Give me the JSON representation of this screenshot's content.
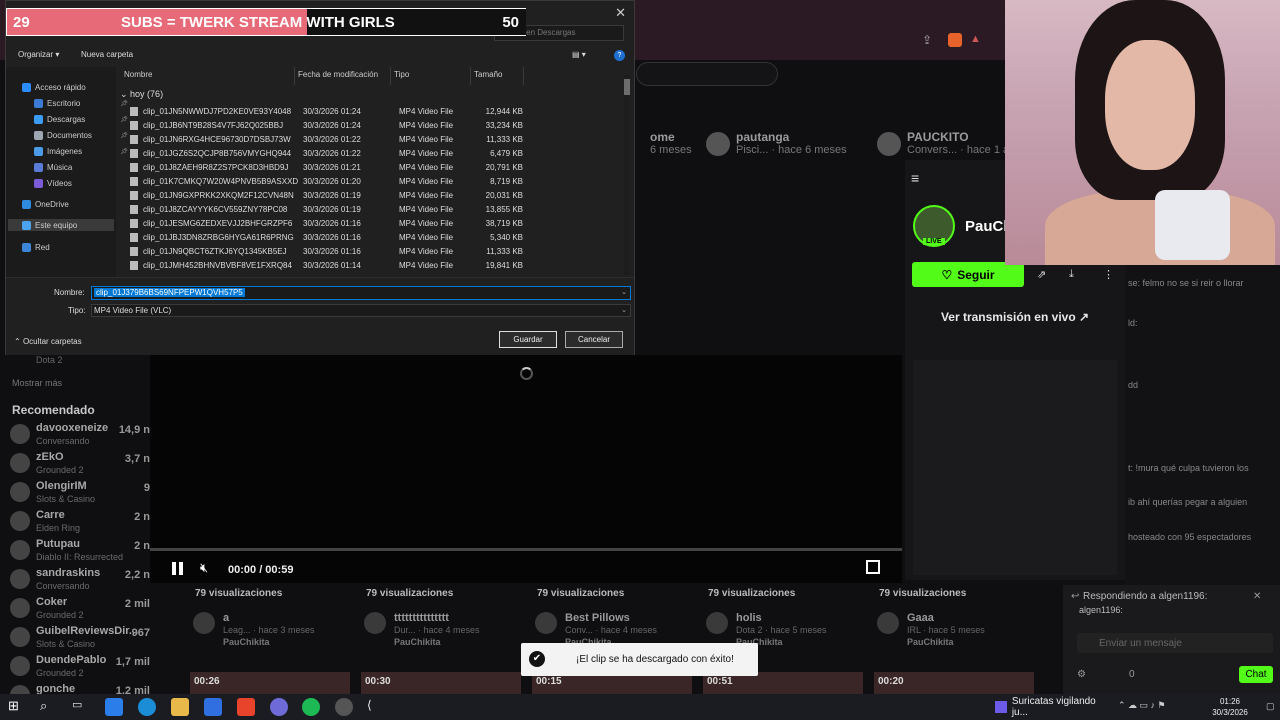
{
  "banner": {
    "left_count": "29",
    "title": "SUBS = TWERK STREAM WITH GIRLS",
    "right_count": "50"
  },
  "dialog": {
    "search_placeholder": "Buscar en Descargas",
    "toolbar": {
      "organize": "Organizar ▾",
      "new_folder": "Nueva carpeta"
    },
    "close_glyph": "✕",
    "nav": [
      {
        "label": "Acceso rápido",
        "icon": "star-icon",
        "color": "#2b8cff"
      },
      {
        "label": "Escritorio",
        "icon": "desktop-icon",
        "color": "#3b7bd6"
      },
      {
        "label": "Descargas",
        "icon": "download-icon",
        "color": "#3b9cf3"
      },
      {
        "label": "Documentos",
        "icon": "documents-icon",
        "color": "#9fa7b3"
      },
      {
        "label": "Imágenes",
        "icon": "pictures-icon",
        "color": "#4c9be8"
      },
      {
        "label": "Música",
        "icon": "music-icon",
        "color": "#5a7bd8"
      },
      {
        "label": "Vídeos",
        "icon": "video-icon",
        "color": "#7b5bd8"
      },
      {
        "label": "OneDrive",
        "icon": "cloud-icon",
        "color": "#2f8be0"
      },
      {
        "label": "Este equipo",
        "icon": "computer-icon",
        "color": "#4ba3f0"
      },
      {
        "label": "Red",
        "icon": "network-icon",
        "color": "#3b86d6"
      }
    ],
    "columns": {
      "name": "Nombre",
      "date": "Fecha de modificación",
      "type": "Tipo",
      "size": "Tamaño"
    },
    "group": "hoy (76)",
    "files": [
      {
        "name": "clip_01JN5NWWDJ7PD2KE0VE93Y4048",
        "date": "30/3/2026 01:24",
        "type": "MP4 Video File",
        "size": "12,944 KB"
      },
      {
        "name": "clip_01JB6NT9B28S4V7FJ62Q025BBJ",
        "date": "30/3/2026 01:24",
        "type": "MP4 Video File",
        "size": "33,234 KB"
      },
      {
        "name": "clip_01JN6RXG4HCE96730D7DSBJ73W",
        "date": "30/3/2026 01:22",
        "type": "MP4 Video File",
        "size": "11,333 KB"
      },
      {
        "name": "clip_01JGZ6S2QCJP8B756VMYGHQ944",
        "date": "30/3/2026 01:22",
        "type": "MP4 Video File",
        "size": "6,479 KB"
      },
      {
        "name": "clip_01J8ZAEH9R8Z2S7PCK8D3HBD9J",
        "date": "30/3/2026 01:21",
        "type": "MP4 Video File",
        "size": "20,791 KB"
      },
      {
        "name": "clip_01K7CMKQ7W20W4PNVB5B9ASXXD",
        "date": "30/3/2026 01:20",
        "type": "MP4 Video File",
        "size": "8,719 KB"
      },
      {
        "name": "clip_01JN9GXPRKK2XKQM2F12CVN48N",
        "date": "30/3/2026 01:19",
        "type": "MP4 Video File",
        "size": "20,031 KB"
      },
      {
        "name": "clip_01J8ZCAYYYK6CV559ZNY78PC08",
        "date": "30/3/2026 01:19",
        "type": "MP4 Video File",
        "size": "13,855 KB"
      },
      {
        "name": "clip_01JESMG6ZEDXEVJJ2BHFGRZPF6",
        "date": "30/3/2026 01:16",
        "type": "MP4 Video File",
        "size": "38,719 KB"
      },
      {
        "name": "clip_01JBJ3DN8ZRBG6HYGA61R6PRNG",
        "date": "30/3/2026 01:16",
        "type": "MP4 Video File",
        "size": "5,340 KB"
      },
      {
        "name": "clip_01JN9QBCT6ZTKJ6YQ1345KB5EJ",
        "date": "30/3/2026 01:16",
        "type": "MP4 Video File",
        "size": "11,333 KB"
      },
      {
        "name": "clip_01JMH452BHNVBVBF8VE1FXRQ84",
        "date": "30/3/2026 01:14",
        "type": "MP4 Video File",
        "size": "19,841 KB"
      }
    ],
    "filename_label": "Nombre:",
    "filename_value": "clip_01J379B6BS69NFPEPW1QVH57P5",
    "filetype_label": "Tipo:",
    "filetype_value": "MP4 Video File (VLC)",
    "hide_folders": "Ocultar carpetas",
    "save_button": "Guardar",
    "cancel_button": "Cancelar"
  },
  "background": {
    "cards": [
      {
        "title": "ome",
        "meta": "6 meses"
      },
      {
        "title": "pautanga",
        "meta": "Pisci... · hace 6 meses"
      },
      {
        "title": "PAUCKITO",
        "meta": "Convers... · hace 1 año"
      }
    ],
    "show_more": "Mostrar más",
    "recommended_title": "Recomendado",
    "dota_label": "Dota 2",
    "channels": [
      {
        "name": "davooxeneize",
        "game": "Conversando",
        "viewers": "14,9 n"
      },
      {
        "name": "zEkO",
        "game": "Grounded 2",
        "viewers": "3,7 n"
      },
      {
        "name": "OlengirIM",
        "game": "Slots & Casino",
        "viewers": "9"
      },
      {
        "name": "Carre",
        "game": "Elden Ring",
        "viewers": "2 n"
      },
      {
        "name": "Putupau",
        "game": "Diablo II: Resurrected",
        "viewers": "2 n"
      },
      {
        "name": "sandraskins",
        "game": "Conversando",
        "viewers": "2,2 n"
      },
      {
        "name": "Coker",
        "game": "Grounded 2",
        "viewers": "2 mil"
      },
      {
        "name": "GuibelReviewsDir...",
        "game": "Slots & Casino",
        "viewers": "967"
      },
      {
        "name": "DuendePablo",
        "game": "Grounded 2",
        "viewers": "1,7 mil"
      },
      {
        "name": "gonche",
        "game": "",
        "viewers": "1,2 mil"
      }
    ],
    "player_time": "00:00 / 00:59",
    "player_progress_fraction": 0.0,
    "videos": [
      {
        "views": "79 visualizaciones",
        "title": "a",
        "meta": "Leag... · hace 3 meses",
        "owner": "PauChikita",
        "duration": "00:26"
      },
      {
        "views": "79 visualizaciones",
        "title": "ttttttttttttttt",
        "meta": "Dur... · hace 4 meses",
        "owner": "PauChikita",
        "duration": "00:30"
      },
      {
        "views": "79 visualizaciones",
        "title": "Best Pillows",
        "meta": "Conv... · hace 4 meses",
        "owner": "PauChikita",
        "duration": "00:15"
      },
      {
        "views": "79 visualizaciones",
        "title": "holis",
        "meta": "Dota 2 · hace 5 meses",
        "owner": "PauChikita",
        "duration": "00:51"
      },
      {
        "views": "79 visualizaciones",
        "title": "Gaaa",
        "meta": "IRL · hace 5 meses",
        "owner": "PauChikita",
        "duration": "00:20"
      }
    ],
    "profile_name": "PauCh",
    "live_badge": "LIVE",
    "follow_button": "Seguir",
    "watch_live": "Ver transmisión en vivo ↗",
    "chat_lines": [
      "se: felmo no se si reir o llorar",
      "ld:",
      "dd",
      "t: !mura qué culpa tuvieron los",
      "ib ahí querías pegar a alguien",
      "hosteado con 95 espectadores"
    ],
    "reply_to": "Respondiendo a algen1196:",
    "reply_user": "algen1196:",
    "chat_placeholder": "Enviar un mensaje",
    "chat_points": "0",
    "chat_button": "Chat",
    "toast": "¡El clip se ha descargado con éxito!"
  },
  "taskbar": {
    "task_label": "Suricatas vigilando ju...",
    "time": "01:26",
    "date": "30/3/2026"
  },
  "colors": {
    "kick_green": "#53fc18",
    "dialog_bg": "#202020",
    "accent_blue": "#0078d4",
    "banner_pink": "#e76a78"
  }
}
